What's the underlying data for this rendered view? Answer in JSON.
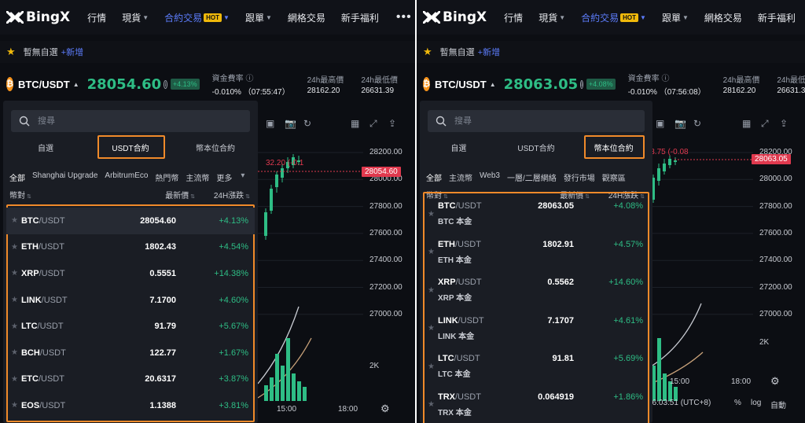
{
  "colors": {
    "accent": "#5c7cfa",
    "up": "#2ebd85",
    "down": "#e0394e",
    "highlight": "#f08a2a",
    "hot": "#f0b90b"
  },
  "left": {
    "logo": "BingX",
    "nav": [
      {
        "label": "行情",
        "caret": false
      },
      {
        "label": "現貨",
        "caret": true
      },
      {
        "label": "合約交易",
        "caret": true,
        "active": true,
        "badge": "HOT"
      },
      {
        "label": "跟單",
        "caret": true
      },
      {
        "label": "網格交易",
        "caret": false
      },
      {
        "label": "新手福利",
        "caret": false
      }
    ],
    "more": "•••",
    "fav": {
      "empty": "暫無自選",
      "add": "+新增"
    },
    "ticker": {
      "pair": "BTC/USDT",
      "price": "28054.60",
      "change": "+4.13%",
      "stats": [
        {
          "label": "資金費率 ⓘ",
          "value": "-0.010% （07:55:47）"
        },
        {
          "label": "24h最高價",
          "value": "28162.20"
        },
        {
          "label": "24h最低價",
          "value": "26631.39"
        }
      ]
    },
    "search_placeholder": "搜尋",
    "tabs": [
      "自選",
      "USDT合約",
      "幣本位合約"
    ],
    "active_tab": 1,
    "categories": [
      "全部",
      "Shanghai Upgrade",
      "ArbitrumEco",
      "熱門幣",
      "主流幣",
      "更多"
    ],
    "columns": {
      "pair": "幣對",
      "price": "最新價",
      "change": "24H漲跌"
    },
    "rows": [
      {
        "base": "BTC",
        "quote": "/USDT",
        "price": "28054.60",
        "change": "+4.13%"
      },
      {
        "base": "ETH",
        "quote": "/USDT",
        "price": "1802.43",
        "change": "+4.54%"
      },
      {
        "base": "XRP",
        "quote": "/USDT",
        "price": "0.5551",
        "change": "+14.38%"
      },
      {
        "base": "LINK",
        "quote": "/USDT",
        "price": "7.1700",
        "change": "+4.60%"
      },
      {
        "base": "LTC",
        "quote": "/USDT",
        "price": "91.79",
        "change": "+5.67%"
      },
      {
        "base": "BCH",
        "quote": "/USDT",
        "price": "122.77",
        "change": "+1.67%"
      },
      {
        "base": "ETC",
        "quote": "/USDT",
        "price": "20.6317",
        "change": "+3.87%"
      },
      {
        "base": "EOS",
        "quote": "/USDT",
        "price": "1.1388",
        "change": "+3.81%"
      }
    ],
    "chart": {
      "y_ticks": [
        "28200.00",
        "28000.00",
        "27800.00",
        "27600.00",
        "27400.00",
        "27200.00",
        "27000.00"
      ],
      "price_tag": "28054.60",
      "overlay_text": "32.20 (-0.1",
      "vol_label": "2K",
      "time_labels": [
        "15:00",
        "18:00"
      ]
    }
  },
  "right": {
    "logo": "BingX",
    "nav": [
      {
        "label": "行情",
        "caret": false
      },
      {
        "label": "現貨",
        "caret": true
      },
      {
        "label": "合約交易",
        "caret": true,
        "active": true,
        "badge": "HOT"
      },
      {
        "label": "跟單",
        "caret": true
      },
      {
        "label": "網格交易",
        "caret": false
      },
      {
        "label": "新手福利",
        "caret": false
      }
    ],
    "fav": {
      "empty": "暫無自選",
      "add": "+新增"
    },
    "ticker": {
      "pair": "BTC/USDT",
      "price": "28063.05",
      "change": "+4.08%",
      "stats": [
        {
          "label": "資金費率 ⓘ",
          "value": "-0.010% （07:56:08）"
        },
        {
          "label": "24h最高價",
          "value": "28162.20"
        },
        {
          "label": "24h最低價",
          "value": "26631.39"
        }
      ]
    },
    "search_placeholder": "搜尋",
    "tabs": [
      "自選",
      "USDT合約",
      "幣本位合約"
    ],
    "active_tab": 2,
    "categories": [
      "全部",
      "主流幣",
      "Web3",
      "一層/二層網絡",
      "發行市場",
      "觀察區"
    ],
    "columns": {
      "pair": "幣對",
      "price": "最新價",
      "change": "24H漲跌"
    },
    "rows": [
      {
        "base": "BTC",
        "quote": "/USDT",
        "sub": "BTC 本金",
        "price": "28063.05",
        "change": "+4.08%"
      },
      {
        "base": "ETH",
        "quote": "/USDT",
        "sub": "ETH 本金",
        "price": "1802.91",
        "change": "+4.57%"
      },
      {
        "base": "XRP",
        "quote": "/USDT",
        "sub": "XRP 本金",
        "price": "0.5562",
        "change": "+14.60%"
      },
      {
        "base": "LINK",
        "quote": "/USDT",
        "sub": "LINK 本金",
        "price": "7.1707",
        "change": "+4.61%"
      },
      {
        "base": "LTC",
        "quote": "/USDT",
        "sub": "LTC 本金",
        "price": "91.81",
        "change": "+5.69%"
      },
      {
        "base": "TRX",
        "quote": "/USDT",
        "sub": "TRX 本金",
        "price": "0.064919",
        "change": "+1.86%"
      }
    ],
    "chart": {
      "y_ticks": [
        "28200.00",
        "28000.00",
        "27800.00",
        "27600.00",
        "27400.00",
        "27200.00",
        "27000.00"
      ],
      "price_tag": "28063.05",
      "overlay_text": "5 -23.75 (-0.08",
      "vol_label": "2K",
      "time_labels": [
        "15:00",
        "18:00"
      ],
      "footer": {
        "clock": "16:03:51 (UTC+8)",
        "pct": "%",
        "log": "log",
        "auto": "自動"
      }
    }
  }
}
